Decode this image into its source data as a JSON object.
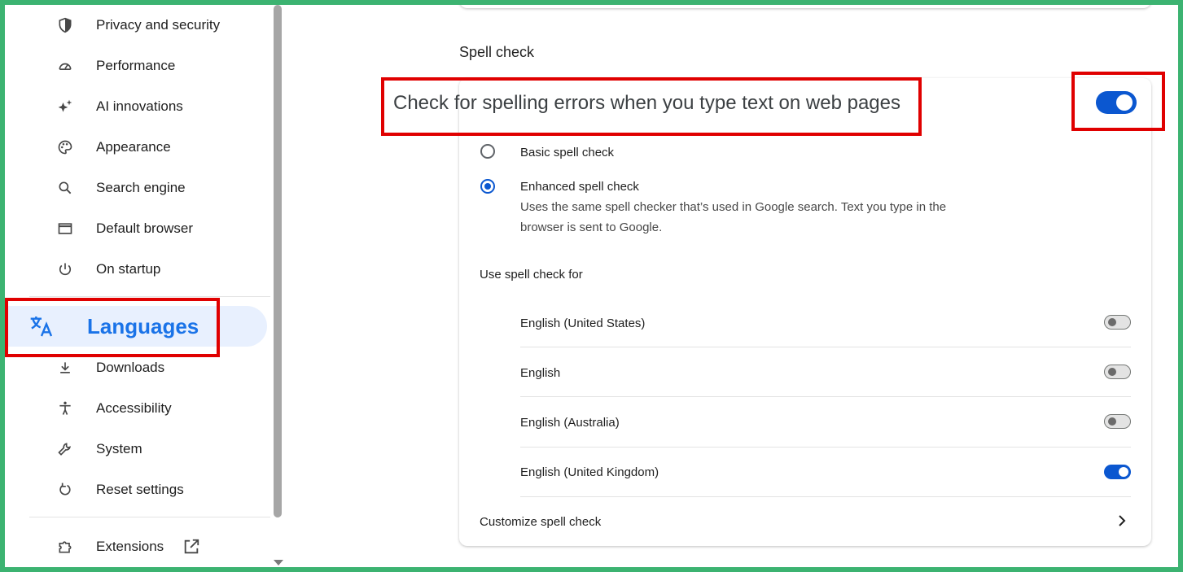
{
  "sidebar": {
    "items": [
      {
        "label": "Privacy and security",
        "icon": "shield-icon"
      },
      {
        "label": "Performance",
        "icon": "speedometer-icon"
      },
      {
        "label": "AI innovations",
        "icon": "sparkle-icon"
      },
      {
        "label": "Appearance",
        "icon": "palette-icon"
      },
      {
        "label": "Search engine",
        "icon": "search-icon"
      },
      {
        "label": "Default browser",
        "icon": "browser-window-icon"
      },
      {
        "label": "On startup",
        "icon": "power-icon"
      },
      {
        "label": "Languages",
        "icon": "translate-icon"
      },
      {
        "label": "Downloads",
        "icon": "download-icon"
      },
      {
        "label": "Accessibility",
        "icon": "accessibility-icon"
      },
      {
        "label": "System",
        "icon": "wrench-icon"
      },
      {
        "label": "Reset settings",
        "icon": "reset-icon"
      },
      {
        "label": "Extensions",
        "icon": "puzzle-icon"
      }
    ],
    "active": "Languages"
  },
  "spellcheck": {
    "section_title": "Spell check",
    "main_toggle_label": "Check for spelling errors when you type text on web pages",
    "main_toggle_on": true,
    "basic_label": "Basic spell check",
    "enhanced_label": "Enhanced spell check",
    "enhanced_desc": "Uses the same spell checker that’s used in Google search. Text you type in the browser is sent to Google.",
    "selected": "Enhanced spell check",
    "use_for_label": "Use spell check for",
    "languages": [
      {
        "name": "English (United States)",
        "enabled": false
      },
      {
        "name": "English",
        "enabled": false
      },
      {
        "name": "English (Australia)",
        "enabled": false
      },
      {
        "name": "English (United Kingdom)",
        "enabled": true
      }
    ],
    "customize_label": "Customize spell check"
  },
  "colors": {
    "accent": "#0b57d0",
    "active_nav_bg": "#e8f0fe",
    "active_nav_text": "#1a73e8",
    "highlight": "#e00000",
    "frame": "#3cb371"
  }
}
